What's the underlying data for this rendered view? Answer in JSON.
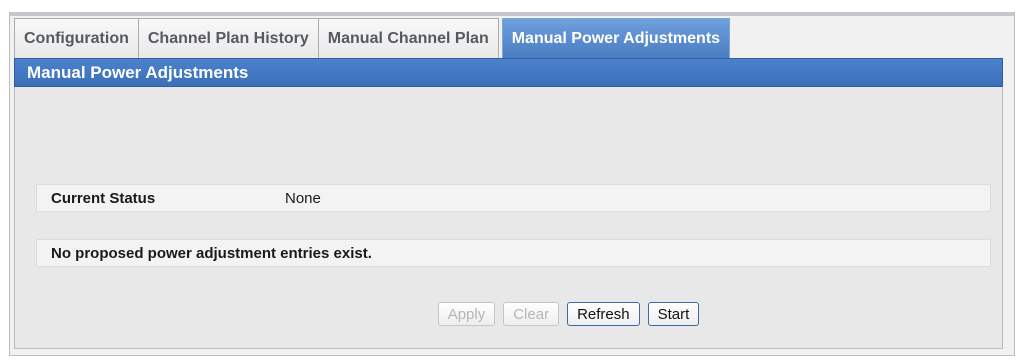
{
  "tabs": [
    {
      "label": "Configuration",
      "active": false
    },
    {
      "label": "Channel Plan History",
      "active": false
    },
    {
      "label": "Manual Channel Plan",
      "active": false
    },
    {
      "label": "Manual Power Adjustments",
      "active": true
    }
  ],
  "panel": {
    "title": "Manual Power Adjustments",
    "status": {
      "label": "Current Status",
      "value": "None"
    },
    "entries_message": "No proposed power adjustment entries exist."
  },
  "buttons": {
    "apply": "Apply",
    "clear": "Clear",
    "refresh": "Refresh",
    "start": "Start"
  },
  "colors": {
    "header_blue": "#4c82cc",
    "active_tab_blue": "#5a8dd0",
    "disabled_text": "#b6b6b6"
  }
}
